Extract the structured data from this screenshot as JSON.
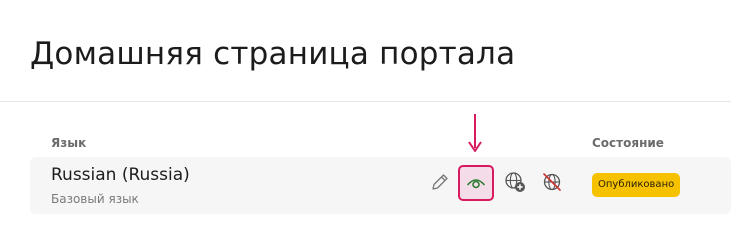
{
  "page": {
    "title": "Домашняя страница портала"
  },
  "table": {
    "headers": {
      "language": "Язык",
      "state": "Состояние"
    },
    "rows": [
      {
        "name": "Russian (Russia)",
        "subtitle": "Базовый язык",
        "status": "Опубликовано",
        "actions": [
          "pencil-icon",
          "eye-icon",
          "globe-add-icon",
          "globe-off-icon"
        ]
      }
    ]
  },
  "colors": {
    "accent": "#d81b60",
    "view_icon": "#2e7d32",
    "status_badge": "#f6c200",
    "row_background": "#f6f6f7"
  }
}
